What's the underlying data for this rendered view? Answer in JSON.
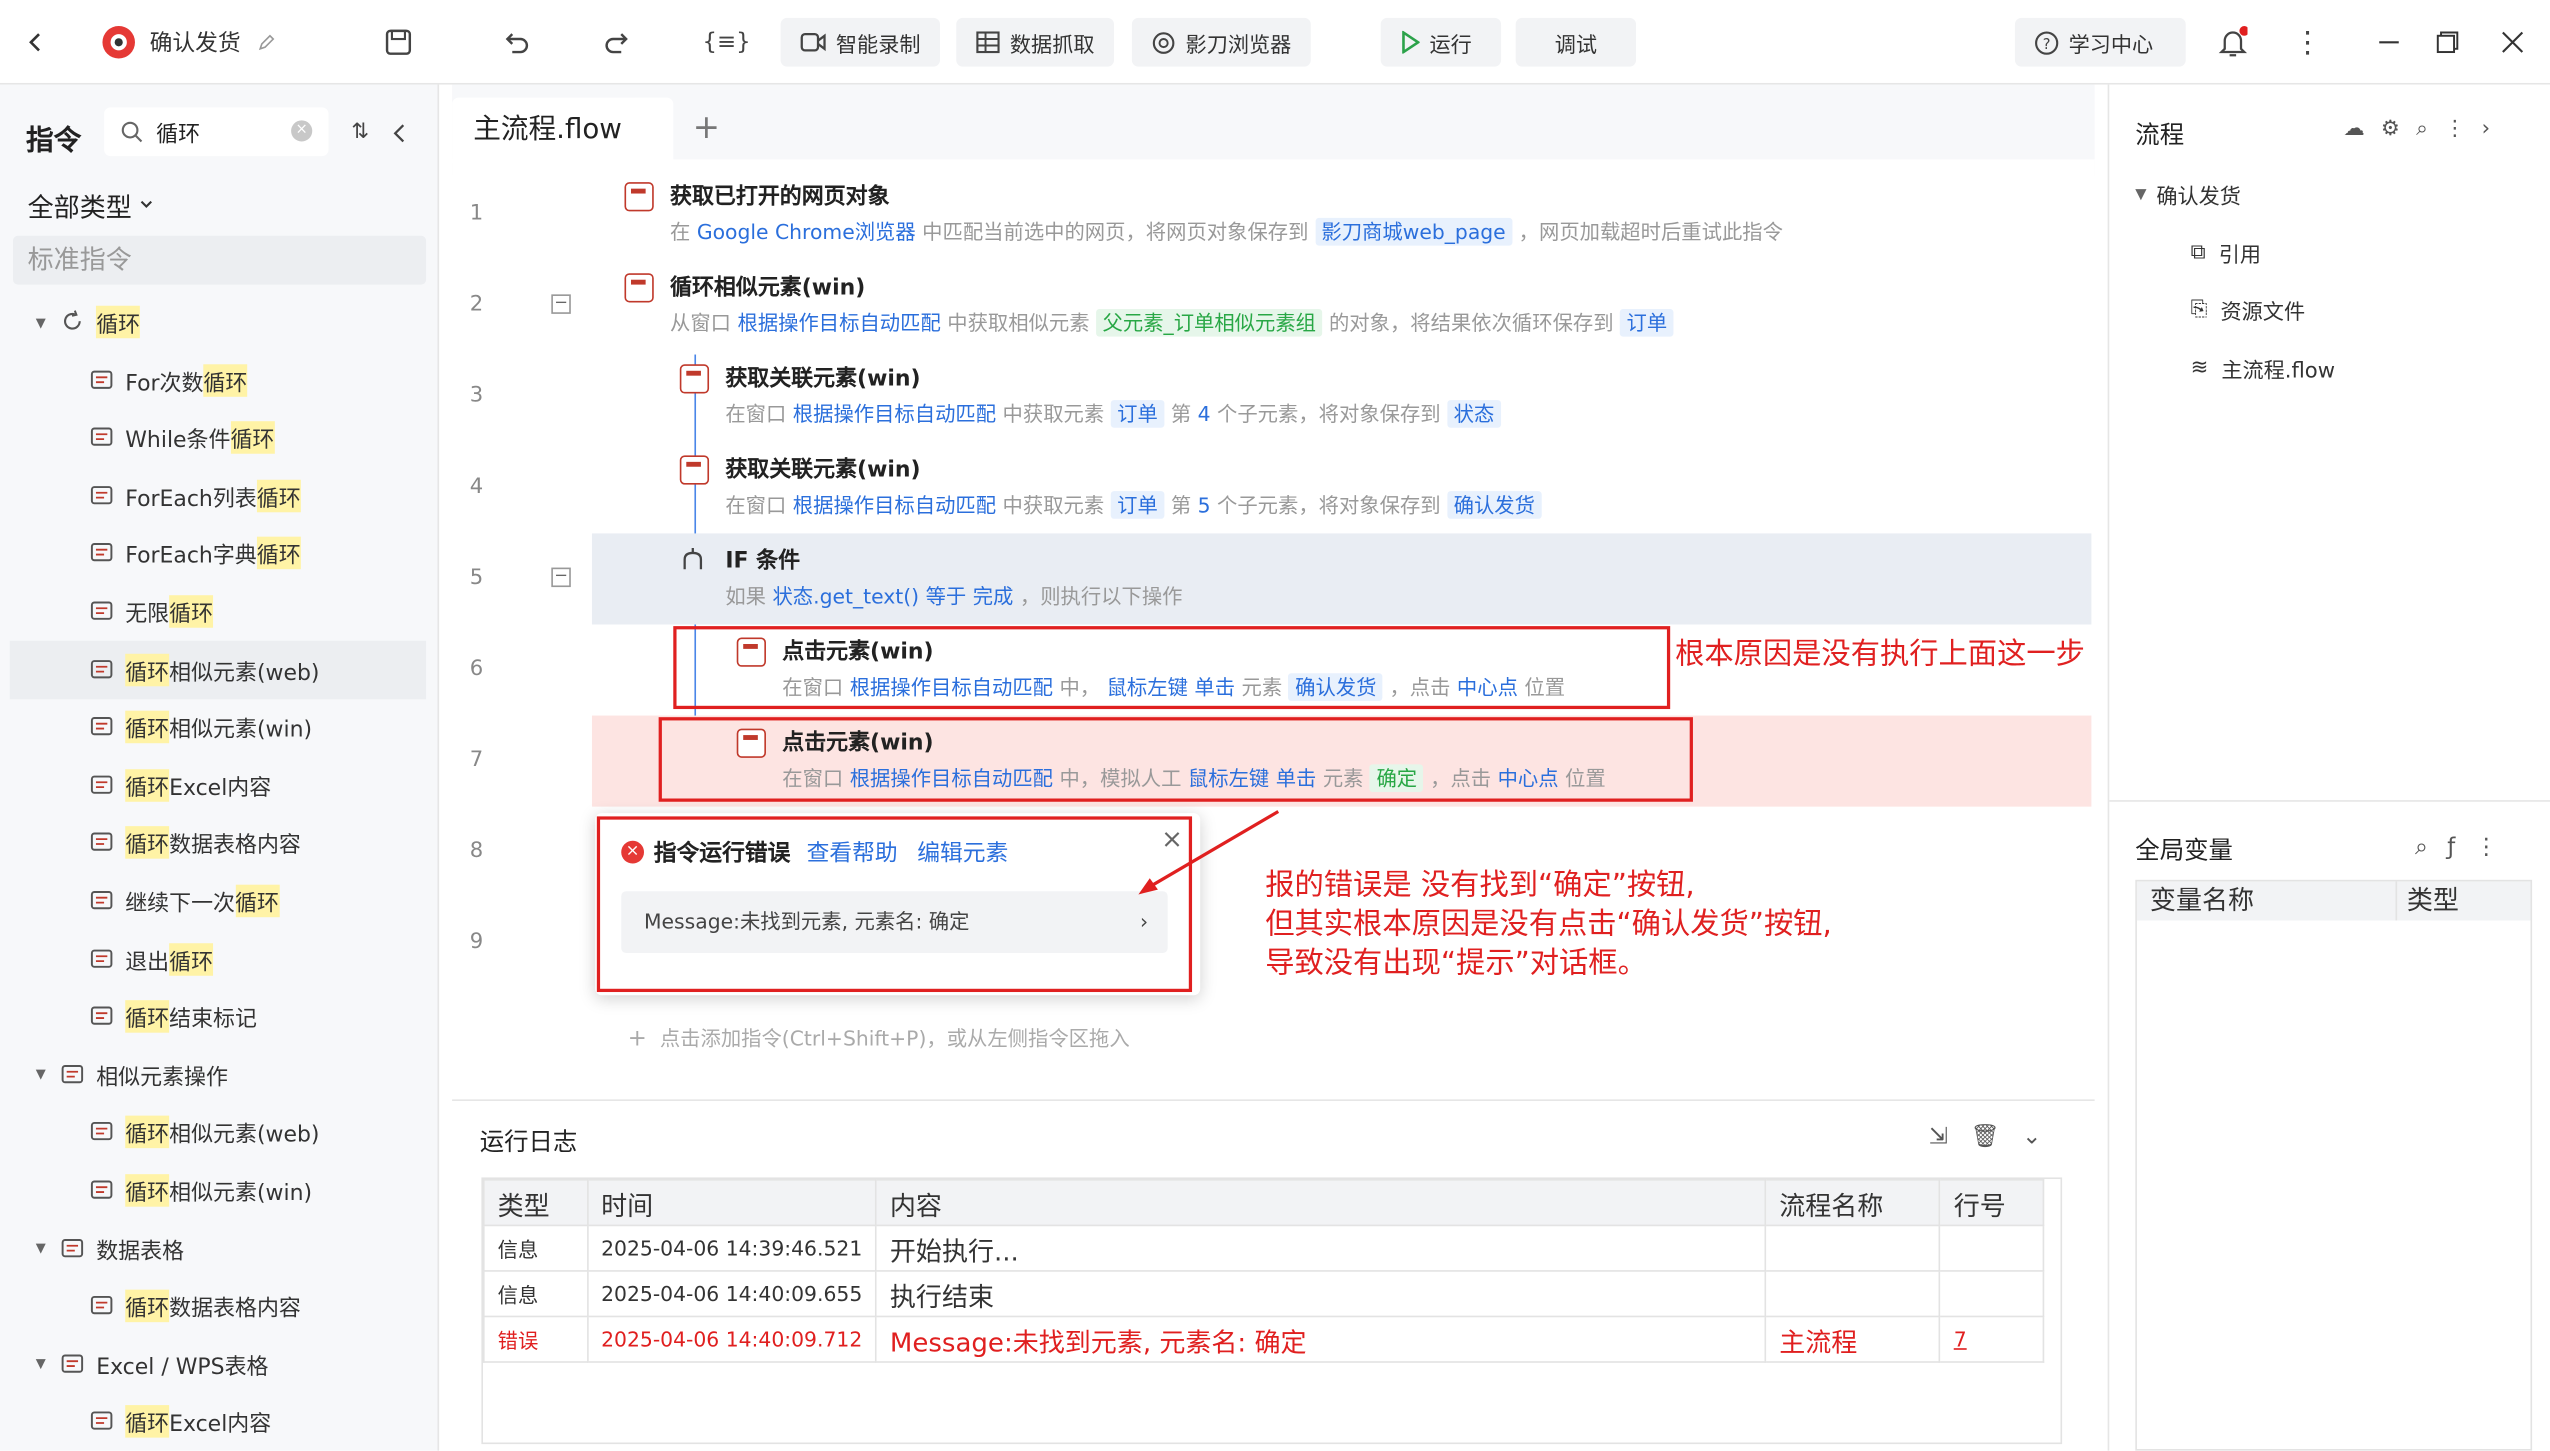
{
  "colors": {
    "accent": "#2b6fdc",
    "error": "#e01f1f",
    "annotation": "#e02020",
    "highlight": "#fff3a6"
  },
  "toolbar": {
    "title": "确认发货",
    "smart_record": "智能录制",
    "data_scrape": "数据抓取",
    "browser": "影刀浏览器",
    "run": "运行",
    "debug": "调试",
    "learn": "学习中心"
  },
  "left": {
    "title": "指令",
    "search_value": "循环",
    "filter": "全部类型",
    "section": "标准指令",
    "items": [
      {
        "pre": "",
        "hl": "循环",
        "post": "",
        "level": 0,
        "icon": "loop-icon"
      },
      {
        "pre": "For次数",
        "hl": "循环",
        "post": "",
        "level": 1,
        "icon": "command-icon"
      },
      {
        "pre": "While条件",
        "hl": "循环",
        "post": "",
        "level": 1,
        "icon": "command-icon"
      },
      {
        "pre": "ForEach列表",
        "hl": "循环",
        "post": "",
        "level": 1,
        "icon": "command-icon"
      },
      {
        "pre": "ForEach字典",
        "hl": "循环",
        "post": "",
        "level": 1,
        "icon": "command-icon"
      },
      {
        "pre": "无限",
        "hl": "循环",
        "post": "",
        "level": 1,
        "icon": "command-icon"
      },
      {
        "pre": "",
        "hl": "循环",
        "post": "相似元素(web)",
        "level": 1,
        "icon": "command-icon",
        "selected": true
      },
      {
        "pre": "",
        "hl": "循环",
        "post": "相似元素(win)",
        "level": 1,
        "icon": "command-icon"
      },
      {
        "pre": "",
        "hl": "循环",
        "post": "Excel内容",
        "level": 1,
        "icon": "excel-icon"
      },
      {
        "pre": "",
        "hl": "循环",
        "post": "数据表格内容",
        "level": 1,
        "icon": "table-icon"
      },
      {
        "pre": "继续下一次",
        "hl": "循环",
        "post": "",
        "level": 1,
        "icon": "command-icon"
      },
      {
        "pre": "退出",
        "hl": "循环",
        "post": "",
        "level": 1,
        "icon": "command-icon"
      },
      {
        "pre": "",
        "hl": "循环",
        "post": "结束标记",
        "level": 1,
        "icon": "command-icon"
      },
      {
        "pre": "相似元素操作",
        "hl": "",
        "post": "",
        "level": 0,
        "icon": "similar-icon"
      },
      {
        "pre": "",
        "hl": "循环",
        "post": "相似元素(web)",
        "level": 1,
        "icon": "command-icon"
      },
      {
        "pre": "",
        "hl": "循环",
        "post": "相似元素(win)",
        "level": 1,
        "icon": "command-icon"
      },
      {
        "pre": "数据表格",
        "hl": "",
        "post": "",
        "level": 0,
        "icon": "datatable-icon"
      },
      {
        "pre": "",
        "hl": "循环",
        "post": "数据表格内容",
        "level": 1,
        "icon": "table-icon"
      },
      {
        "pre": "Excel / WPS表格",
        "hl": "",
        "post": "",
        "level": 0,
        "icon": "excel-group-icon"
      },
      {
        "pre": "",
        "hl": "循环",
        "post": "Excel内容",
        "level": 1,
        "icon": "excel-icon"
      }
    ]
  },
  "editor": {
    "tab": "主流程.flow",
    "add_hint": "点击添加指令(Ctrl+Shift+P)，或从左侧指令区拖入",
    "line_numbers": [
      "1",
      "2",
      "3",
      "4",
      "5",
      "6",
      "7",
      "8",
      "9"
    ],
    "c1": {
      "title": "获取已打开的网页对象",
      "a": "在 ",
      "b": "Google Chrome浏览器",
      "c": " 中匹配当前选中的网页，将网页对象保存到 ",
      "d": "影刀商城web_page",
      "e": " ，网页加载超时后重试此指令"
    },
    "c2": {
      "title": "循环相似元素(win)",
      "a": "从窗口 ",
      "b": "根据操作目标自动匹配",
      "c": " 中获取相似元素 ",
      "d": "父元素_订单相似元素组",
      "e": " 的对象，将结果依次循环保存到 ",
      "f": "订单"
    },
    "c3": {
      "title": "获取关联元素(win)",
      "a": "在窗口 ",
      "b": "根据操作目标自动匹配",
      "c": " 中获取元素 ",
      "d": "订单",
      "e": " 第 ",
      "f": "4",
      "g": " 个子元素，将对象保存到 ",
      "h": "状态"
    },
    "c4": {
      "title": "获取关联元素(win)",
      "a": "在窗口 ",
      "b": "根据操作目标自动匹配",
      "c": " 中获取元素 ",
      "d": "订单",
      "e": " 第 ",
      "f": "5",
      "g": " 个子元素，将对象保存到 ",
      "h": "确认发货"
    },
    "c5": {
      "title": "IF 条件",
      "a": "如果 ",
      "b": "状态.get_text()",
      "c": " 等于 ",
      "d": "完成",
      "e": " ，则执行以下操作"
    },
    "c6": {
      "title": "点击元素(win)",
      "a": "在窗口 ",
      "b": "根据操作目标自动匹配",
      "c": " 中， ",
      "d": "鼠标左键 单击",
      "e": " 元素 ",
      "f": "确认发货",
      "g": " ，点击 ",
      "h": "中心点",
      "i": " 位置"
    },
    "c7": {
      "title": "点击元素(win)",
      "a": "在窗口 ",
      "b": "根据操作目标自动匹配",
      "c": " 中，模拟人工 ",
      "d": "鼠标左键 单击",
      "e": " 元素 ",
      "f": "确定",
      "g": " ，点击 ",
      "h": "中心点",
      "i": " 位置"
    }
  },
  "error_popup": {
    "title": "指令运行错误",
    "help": "查看帮助",
    "edit": "编辑元素",
    "message": "Message:未找到元素, 元素名: 确定"
  },
  "annotations": {
    "a1": "根本原因是没有执行上面这一步",
    "a2": "报的错误是 没有找到“确定”按钮,",
    "a3": "但其实根本原因是没有点击“确认发货”按钮,",
    "a4": "导致没有出现“提示”对话框。"
  },
  "right": {
    "title": "流程",
    "root": "确认发货",
    "items": [
      "引用",
      "资源文件",
      "主流程.flow"
    ],
    "vars_title": "全局变量",
    "col_name": "变量名称",
    "col_type": "类型"
  },
  "log": {
    "title": "运行日志",
    "headers": [
      "类型",
      "时间",
      "内容",
      "流程名称",
      "行号"
    ],
    "rows": [
      [
        "信息",
        "2025-04-06 14:39:46.521",
        "开始执行...",
        "",
        ""
      ],
      [
        "信息",
        "2025-04-06 14:40:09.655",
        "执行结束",
        "",
        ""
      ],
      [
        "错误",
        "2025-04-06 14:40:09.712",
        "Message:未找到元素, 元素名: 确定",
        "主流程",
        "7"
      ]
    ]
  }
}
